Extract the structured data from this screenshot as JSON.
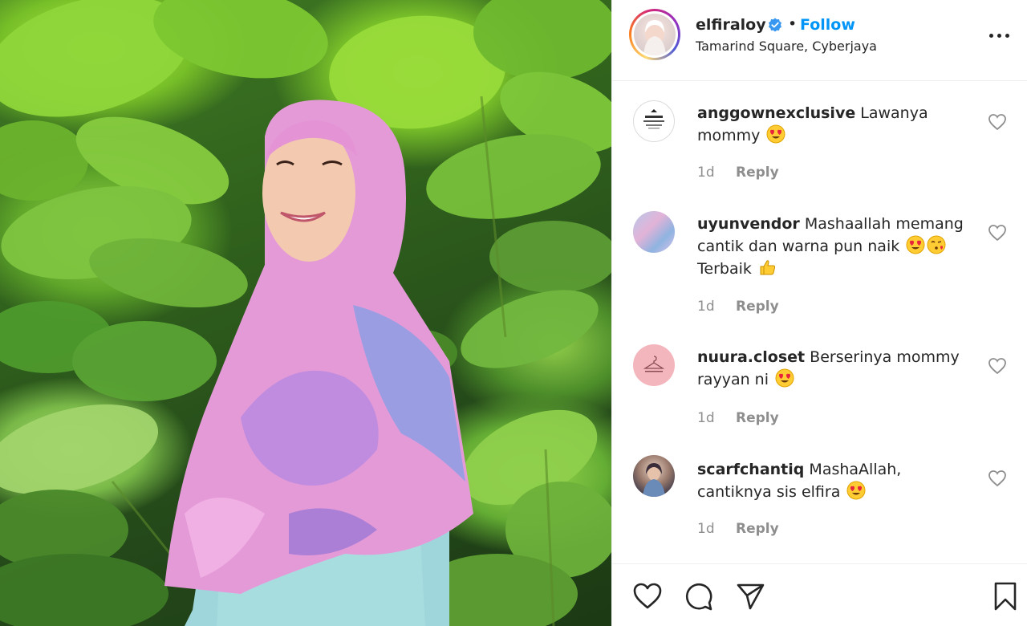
{
  "post": {
    "username": "elfiraloy",
    "separator": "•",
    "follow_label": "Follow",
    "location": "Tamarind Square, Cyberjaya",
    "verified_icon": "verified-badge-icon",
    "more_icon": "more-options-icon"
  },
  "comments": [
    {
      "user": "anggownexclusive",
      "text": "Lawanya mommy",
      "emoji": [
        "heart-eyes"
      ],
      "time": "1d",
      "reply": "Reply"
    },
    {
      "user": "uyunvendor",
      "text": "Mashaallah memang cantik dan warna pun naik",
      "emoji": [
        "heart-eyes",
        "kissing-heart"
      ],
      "text2": "Terbaik",
      "emoji2": [
        "thumbs-up"
      ],
      "time": "1d",
      "reply": "Reply"
    },
    {
      "user": "nuura.closet",
      "text": "Berserinya mommy rayyan ni",
      "emoji": [
        "heart-eyes"
      ],
      "time": "1d",
      "reply": "Reply"
    },
    {
      "user": "scarfchantiq",
      "text": "MashaAllah, cantiknya sis elfira",
      "emoji": [
        "heart-eyes"
      ],
      "time": "1d",
      "reply": "Reply"
    }
  ],
  "actions": [
    "like-icon",
    "comment-icon",
    "share-icon",
    "save-icon"
  ],
  "colors": {
    "accent": "#0095f6",
    "text": "#262626",
    "muted": "#8e8e8e",
    "border": "#efefef",
    "verified": "#3897f0"
  }
}
